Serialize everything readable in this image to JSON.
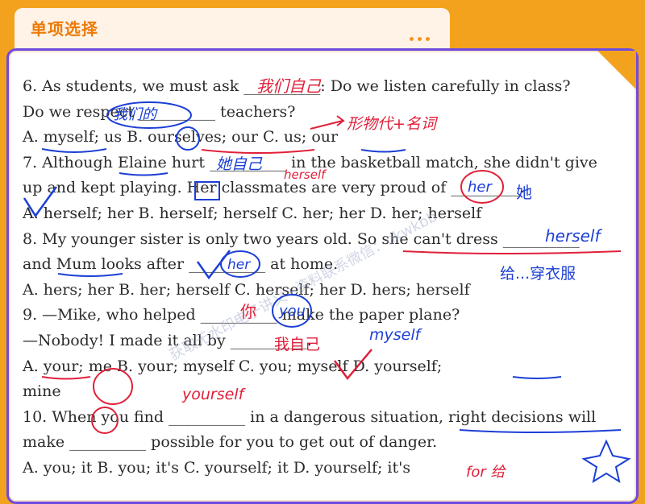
{
  "header": {
    "title": "单项选择"
  },
  "questions": {
    "q6": {
      "line1": "6. As students, we must ask __________: Do we listen carefully in class?",
      "line2": "Do we respect __________ teachers?",
      "options": "A. myself; us            B. ourselves; our          C. us; our"
    },
    "q7": {
      "line1": "7. Although Elaine hurt __________ in the basketball match, she didn't give",
      "line2": "up and kept playing. Her classmates are very proud of _________.",
      "options": "A. herself; her       B. herself; herself      C. her; her             D. her; herself"
    },
    "q8": {
      "line1": "8. My younger sister is only two years old. So she can't dress __________",
      "line2": "and Mum looks after __________ at home.",
      "options": "A. hers; her          B. her; herself          C. herself; her     D. hers; herself"
    },
    "q9": {
      "line1": "9. —Mike, who helped __________ make the paper plane?",
      "line2": "—Nobody! I made it all by __________.",
      "options1": "A. your; me              B. your; myself                C. you; myself             D. yourself;",
      "options2": "mine"
    },
    "q10": {
      "line1": "10. When you find __________ in a dangerous situation, right decisions will",
      "line2": "make __________ possible for you to get out of danger.",
      "options": "A. you; it                   B. you; it's                    C. yourself; it    D. yourself; it's"
    }
  },
  "annotations": {
    "q6_blank1": "我们自己",
    "q6_blank2": "我们的",
    "q6_note": "形物代+名词",
    "q7_blank1": "她自己",
    "q7_blank1b": "herself",
    "q7_blank2": "her",
    "q7_blank2b": "她",
    "q8_blank1": "herself",
    "q8_blank2": "her",
    "q8_note": "给...穿衣服",
    "q9_blank1": "you",
    "q9_blank1b": "你",
    "q9_blank2": "我自己",
    "q9_blank2b": "myself",
    "q9_note": "yourself",
    "q10_note": "for 给"
  },
  "watermark": "获取无水印电子讲义+资料联系微信：okwkbb",
  "colors": {
    "frame": "#f3a21e",
    "title": "#ec7a06",
    "border": "#6d4ae0",
    "pen_blue": "#1c3fd6",
    "pen_red": "#e0203a"
  }
}
